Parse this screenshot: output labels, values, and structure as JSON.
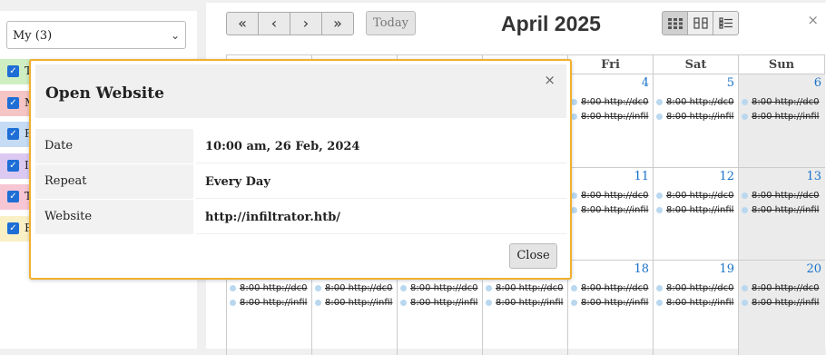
{
  "sidebar": {
    "calendar_select": "My (3)",
    "calendars": [
      {
        "label": "T",
        "color": "#cfeec2"
      },
      {
        "label": "M",
        "color": "#f5c4c4"
      },
      {
        "label": "F",
        "color": "#c6dcf5"
      },
      {
        "label": "I",
        "color": "#dcc9f2"
      },
      {
        "label": "T",
        "color": "#f6c6d4"
      },
      {
        "label": "F",
        "color": "#faf0c6"
      }
    ]
  },
  "toolbar": {
    "first": "«",
    "prev": "‹",
    "next": "›",
    "last": "»",
    "today": "Today",
    "title": "April 2025"
  },
  "calendar": {
    "days": [
      "Fri",
      "Sat",
      "Sun"
    ],
    "weeks": [
      [
        "4",
        "5",
        "6"
      ],
      [
        "11",
        "12",
        "13"
      ],
      [
        "18",
        "19",
        "20"
      ]
    ],
    "event_1": "8:00 http://dc0",
    "event_2": "8:00 http://infil",
    "hidden_left_events": [
      "8:00 http://dc0",
      "8:00 http://dc0",
      "8:00 http://dc0",
      "8:00 http://dc0"
    ],
    "hidden_left_events2": [
      "8:00 http://infil",
      "8:00 http://infil",
      "8:00 http://infil",
      "8:00 http://infil"
    ]
  },
  "modal": {
    "title": "Open Website",
    "close_x": "×",
    "rows": [
      {
        "key": "Date",
        "value": "10:00 am, 26 Feb, 2024"
      },
      {
        "key": "Repeat",
        "value": "Every Day"
      },
      {
        "key": "Website",
        "value": "http://infiltrator.htb/"
      }
    ],
    "close_button": "Close"
  },
  "main_close": "×",
  "accent": "#1e6ed6",
  "modal_border": "#f0b030"
}
